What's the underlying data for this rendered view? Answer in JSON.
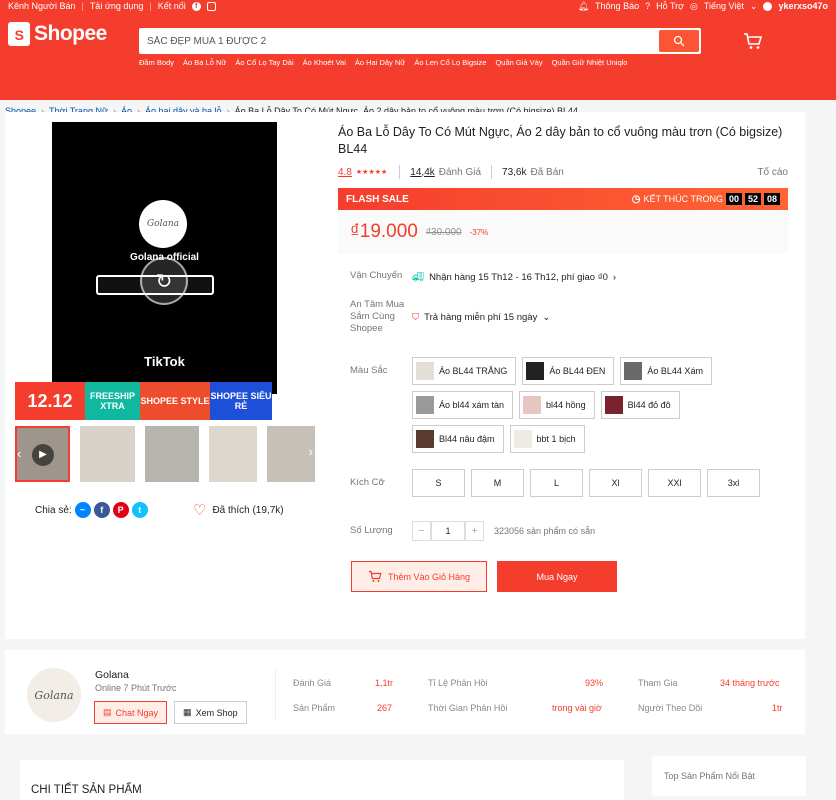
{
  "topnav": {
    "seller_channel": "Kênh Người Bán",
    "download_app": "Tải ứng dụng",
    "connect": "Kết nối",
    "notifications": "Thông Báo",
    "help": "Hỗ Trợ",
    "language": "Tiếng Việt",
    "username": "ykerxso47o"
  },
  "header": {
    "logo_text": "Shopee",
    "search_value": "SẮC ĐẸP MUA 1 ĐƯỢC 2",
    "keywords": [
      "Đầm Body",
      "Áo Ba Lỗ Nữ",
      "Áo Cổ Lọ Tay Dài",
      "Áo Khoét Vai",
      "Áo Hai Dây Nữ",
      "Áo Len Cổ Lọ Bigsize",
      "Quần Giả Váy",
      "Quần Giữ Nhiệt Uniqlo"
    ]
  },
  "breadcrumb": {
    "items": [
      "Shopee",
      "Thời Trang Nữ",
      "Áo",
      "Áo hai dây và ba lỗ"
    ],
    "current": "Áo Ba Lỗ Dây To Có Mút Ngực, Áo 2 dây bản to cổ vuông màu trơn (Có bigsize) BL44"
  },
  "media": {
    "video_brand": "Golana official",
    "tiktok": "TikTok",
    "banner": {
      "sale": "12.12",
      "freeship": "FREESHIP XTRA",
      "style": "SHOPEE STYLE",
      "cheap": "SHOPEE SIÊU RẺ"
    }
  },
  "share": {
    "label": "Chia sẻ:",
    "liked": "Đã thích (19,7k)"
  },
  "product": {
    "title": "Áo Ba Lỗ Dây To Có Mút Ngực, Áo 2 dây bản to cổ vuông màu trơn (Có bigsize) BL44",
    "rating": "4.8",
    "reviews": "14,4k",
    "reviews_label": "Đánh Giá",
    "sold": "73,6k",
    "sold_label": "Đã Bán",
    "report": "Tố cáo",
    "flash_label": "FLASH SALE",
    "ends_label": "KẾT THÚC TRONG",
    "timer": [
      "00",
      "52",
      "08"
    ],
    "price": "₫19.000",
    "old_price": "₫30.000",
    "discount": "-37%",
    "shipping_label": "Vận Chuyển",
    "shipping_value": "Nhận hàng 15 Th12 - 16 Th12, phí giao ₫0",
    "assurance_label": "An Tâm Mua Sắm Cùng Shopee",
    "assurance_value": "Trả hàng miễn phí 15 ngày",
    "color_label": "Màu Sắc",
    "colors": [
      "Áo BL44 TRẮNG",
      "Áo BL44 ĐEN",
      "Áo BL44 Xám",
      "Áo bl44 xám tàn",
      "bl44 hồng",
      "Bl44 đỏ đô",
      "Bl44 nâu đậm",
      "bbt 1 bịch"
    ],
    "size_label": "Kích Cỡ",
    "sizes": [
      "S",
      "M",
      "L",
      "Xl",
      "XXl",
      "3xl"
    ],
    "qty_label": "Số Lượng",
    "qty_value": "1",
    "stock": "323056 sản phẩm có sẵn",
    "add_cart": "Thêm Vào Giỏ Hàng",
    "buy_now": "Mua Ngay"
  },
  "shop": {
    "name": "Golana",
    "online": "Online 7 Phút Trước",
    "chat": "Chat Ngay",
    "view": "Xem Shop",
    "stats": {
      "rating_label": "Đánh Giá",
      "rating": "1,1tr",
      "products_label": "Sản Phẩm",
      "products": "267",
      "response_rate_label": "Tỉ Lệ Phản Hồi",
      "response_rate": "93%",
      "response_time_label": "Thời Gian Phản Hồi",
      "response_time": "trong vài giờ",
      "joined_label": "Tham Gia",
      "joined": "34 tháng trước",
      "followers_label": "Người Theo Dõi",
      "followers": "1tr"
    }
  },
  "detail": {
    "title": "CHI TIẾT SẢN PHẨM",
    "top_products": "Top Sản Phẩm Nổi Bật"
  },
  "colors": {
    "brand": "#f53d2d",
    "link": "#0055aa"
  }
}
